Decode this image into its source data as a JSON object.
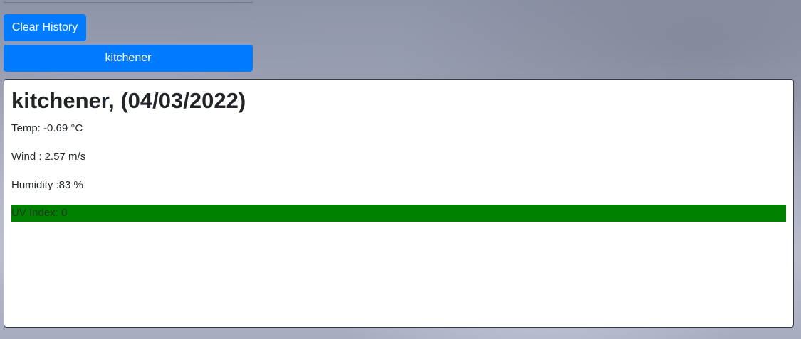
{
  "history": {
    "clear_label": "Clear History",
    "items": [
      {
        "label": "kitchener"
      }
    ]
  },
  "weather": {
    "title": "kitchener, (04/03/2022)",
    "temp": "Temp: -0.69 °C",
    "wind": "Wind : 2.57 m/s",
    "humidity": "Humidity :83 %",
    "uv_index": "UV Index: 0",
    "uv_color": "#008000"
  },
  "colors": {
    "accent": "#007bff",
    "card_border": "#343a40"
  }
}
